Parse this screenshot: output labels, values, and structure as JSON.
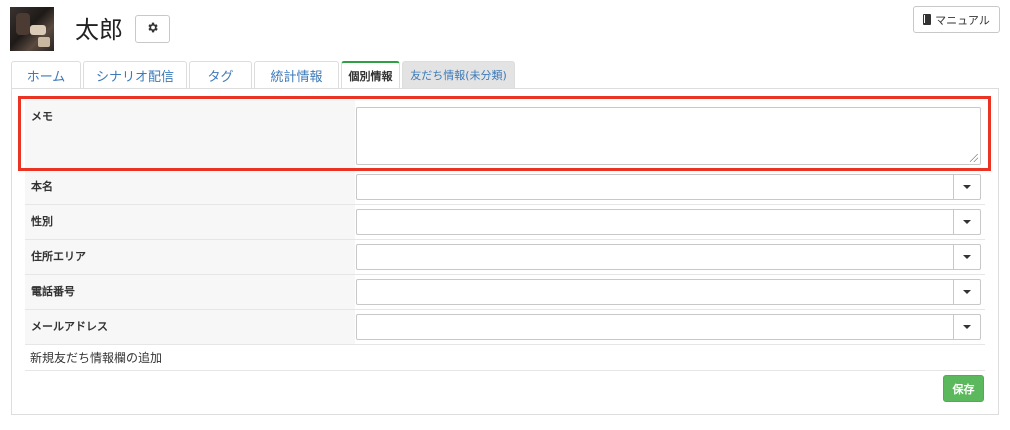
{
  "header": {
    "user_name": "太郎",
    "manual_label": "マニュアル"
  },
  "tabs": [
    {
      "label": "ホーム",
      "state": "normal"
    },
    {
      "label": "シナリオ配信",
      "state": "normal"
    },
    {
      "label": "タグ",
      "state": "normal"
    },
    {
      "label": "統計情報",
      "state": "normal"
    },
    {
      "label": "個別情報",
      "state": "active"
    },
    {
      "label": "友だち情報(未分類)",
      "state": "gray"
    }
  ],
  "form": {
    "memo": {
      "label": "メモ",
      "value": ""
    },
    "fields": [
      {
        "label": "本名",
        "value": ""
      },
      {
        "label": "性別",
        "value": ""
      },
      {
        "label": "住所エリア",
        "value": ""
      },
      {
        "label": "電話番号",
        "value": ""
      },
      {
        "label": "メールアドレス",
        "value": ""
      }
    ],
    "add_field_label": "新規友だち情報欄の追加",
    "save_label": "保存"
  },
  "colors": {
    "highlight": "#ea3323",
    "save_button": "#5cb85c",
    "active_tab_accent": "#2f9e44",
    "link": "#3d7ab8"
  }
}
